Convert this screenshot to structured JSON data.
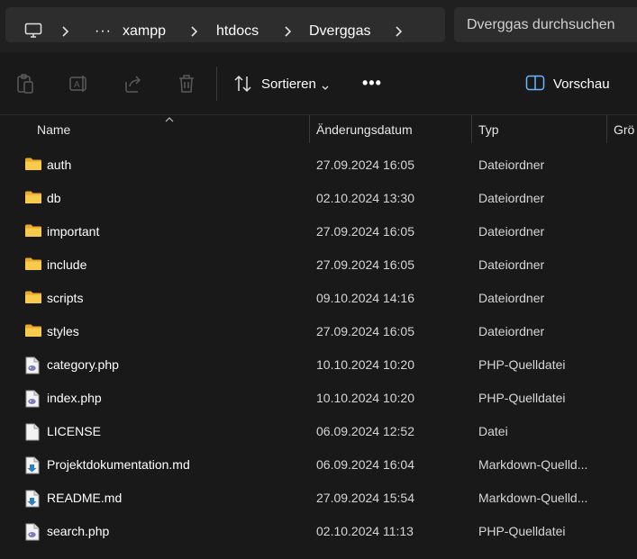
{
  "breadcrumb": {
    "overflow": "···",
    "items": [
      "xampp",
      "htdocs",
      "Dverggas"
    ]
  },
  "search": {
    "placeholder": "Dverggas durchsuchen"
  },
  "toolbar": {
    "sort_label": "Sortieren",
    "more_label": "•••",
    "preview_label": "Vorschau"
  },
  "columns": [
    "Name",
    "Änderungsdatum",
    "Typ",
    "Grö"
  ],
  "files": [
    {
      "name": "auth",
      "date": "27.09.2024 16:05",
      "type": "Dateiordner",
      "icon": "folder-icon"
    },
    {
      "name": "db",
      "date": "02.10.2024 13:30",
      "type": "Dateiordner",
      "icon": "folder-icon"
    },
    {
      "name": "important",
      "date": "27.09.2024 16:05",
      "type": "Dateiordner",
      "icon": "folder-icon"
    },
    {
      "name": "include",
      "date": "27.09.2024 16:05",
      "type": "Dateiordner",
      "icon": "folder-icon"
    },
    {
      "name": "scripts",
      "date": "09.10.2024 14:16",
      "type": "Dateiordner",
      "icon": "folder-icon"
    },
    {
      "name": "styles",
      "date": "27.09.2024 16:05",
      "type": "Dateiordner",
      "icon": "folder-icon"
    },
    {
      "name": "category.php",
      "date": "10.10.2024 10:20",
      "type": "PHP-Quelldatei",
      "icon": "php-file-icon"
    },
    {
      "name": "index.php",
      "date": "10.10.2024 10:20",
      "type": "PHP-Quelldatei",
      "icon": "php-file-icon"
    },
    {
      "name": "LICENSE",
      "date": "06.09.2024 12:52",
      "type": "Datei",
      "icon": "file-icon"
    },
    {
      "name": "Projektdokumentation.md",
      "date": "06.09.2024 16:04",
      "type": "Markdown-Quelld...",
      "icon": "markdown-file-icon"
    },
    {
      "name": "README.md",
      "date": "27.09.2024 15:54",
      "type": "Markdown-Quelld...",
      "icon": "markdown-file-icon"
    },
    {
      "name": "search.php",
      "date": "02.10.2024 11:13",
      "type": "PHP-Quelldatei",
      "icon": "php-file-icon"
    }
  ]
}
